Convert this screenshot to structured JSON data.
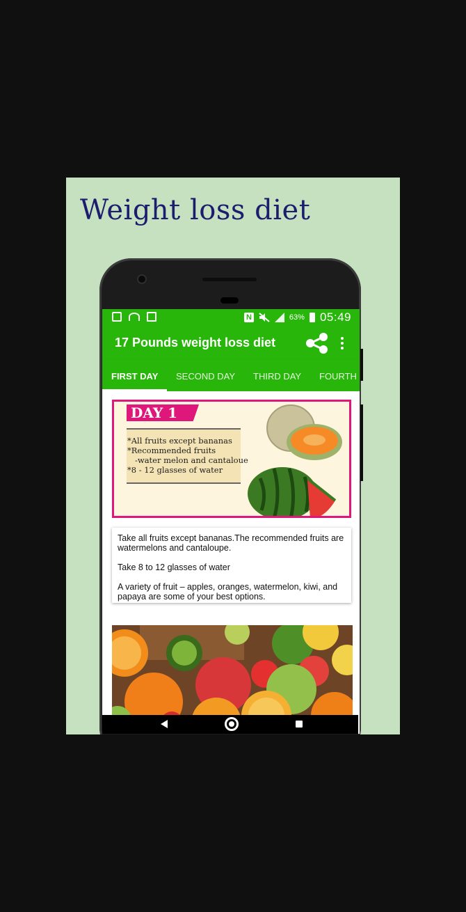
{
  "promo": {
    "title": "Weight loss diet",
    "background": "#c5e1c0"
  },
  "statusbar": {
    "icons": [
      "image-icon",
      "wifi-icon",
      "notes-icon",
      "nfc-icon",
      "mute-icon",
      "signal-icon",
      "battery-icon"
    ],
    "battery": "63%",
    "time": "05:49"
  },
  "appbar": {
    "title": "17 Pounds weight loss diet",
    "accent": "#28b60a"
  },
  "tabs": [
    {
      "label": "FIRST DAY",
      "selected": true
    },
    {
      "label": "SECOND DAY",
      "selected": false
    },
    {
      "label": "THIRD DAY",
      "selected": false
    },
    {
      "label": "FOURTH",
      "selected": false
    }
  ],
  "day_card": {
    "banner": "DAY 1",
    "lines": [
      "*All fruits except bananas",
      "*Recommended fruits",
      "   -water melon and cantaloue",
      "*8 - 12 glasses of water"
    ]
  },
  "description": {
    "paragraphs": [
      "Take all fruits except bananas.The recommended fruits are watermelons and cantaloupe.",
      "Take 8 to 12 glasses of water",
      "A variety of fruit – apples, oranges, watermelon, kiwi, and papaya are some of your best options."
    ]
  },
  "navbar": {
    "icons": [
      "back-icon",
      "home-icon",
      "recents-icon"
    ]
  }
}
